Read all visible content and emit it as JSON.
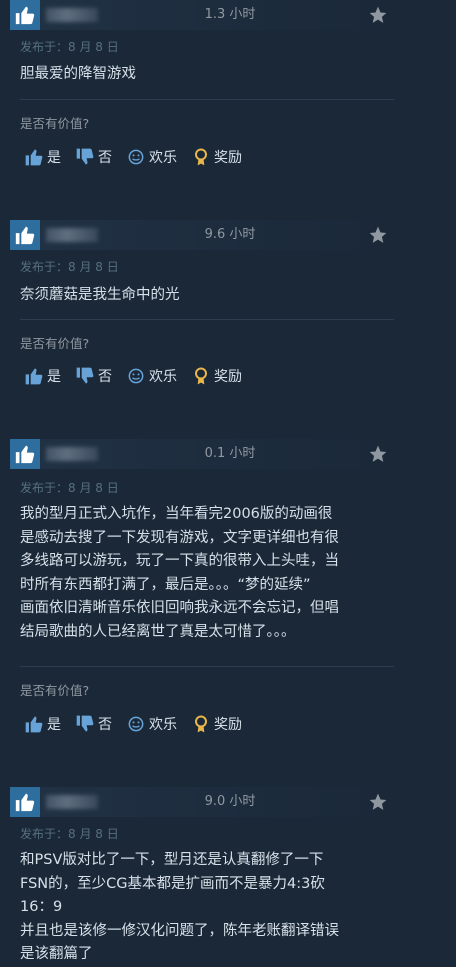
{
  "reviews": [
    {
      "hours": "1.3 小时",
      "posted": "发布于：8 月 8 日",
      "content": [
        "胆最爱的降智游戏"
      ],
      "helpful_label": "是否有价值?",
      "votes": {
        "yes": "是",
        "no": "否",
        "funny": "欢乐",
        "award": "奖励"
      }
    },
    {
      "hours": "9.6 小时",
      "posted": "发布于：8 月 8 日",
      "content": [
        "奈须蘑菇是我生命中的光"
      ],
      "helpful_label": "是否有价值?",
      "votes": {
        "yes": "是",
        "no": "否",
        "funny": "欢乐",
        "award": "奖励"
      }
    },
    {
      "hours": "0.1 小时",
      "posted": "发布于：8 月 8 日",
      "content": [
        "我的型月正式入坑作，当年看完2006版的动画很",
        "是感动去搜了一下发现有游戏，文字更详细也有很",
        "多线路可以游玩，玩了一下真的很带入上头哇，当",
        "时所有东西都打满了，最后是。。。“梦的延续”",
        "画面依旧清晰音乐依旧回响我永远不会忘记，但唱",
        "结局歌曲的人已经离世了真是太可惜了。。。"
      ],
      "helpful_label": "是否有价值?",
      "votes": {
        "yes": "是",
        "no": "否",
        "funny": "欢乐",
        "award": "奖励"
      }
    },
    {
      "hours": "9.0 小时",
      "posted": "发布于：8 月 8 日",
      "content": [
        "和PSV版对比了一下，型月还是认真翻修了一下",
        "FSN的，至少CG基本都是扩画而不是暴力4:3砍",
        "16：9",
        "并且也是该修一修汉化问题了，陈年老账翻译错误",
        "是该翻篇了"
      ]
    }
  ],
  "colors": {
    "background": "#1b2838",
    "thumb": "#2e6e9e",
    "accent": "#e8b64a"
  }
}
